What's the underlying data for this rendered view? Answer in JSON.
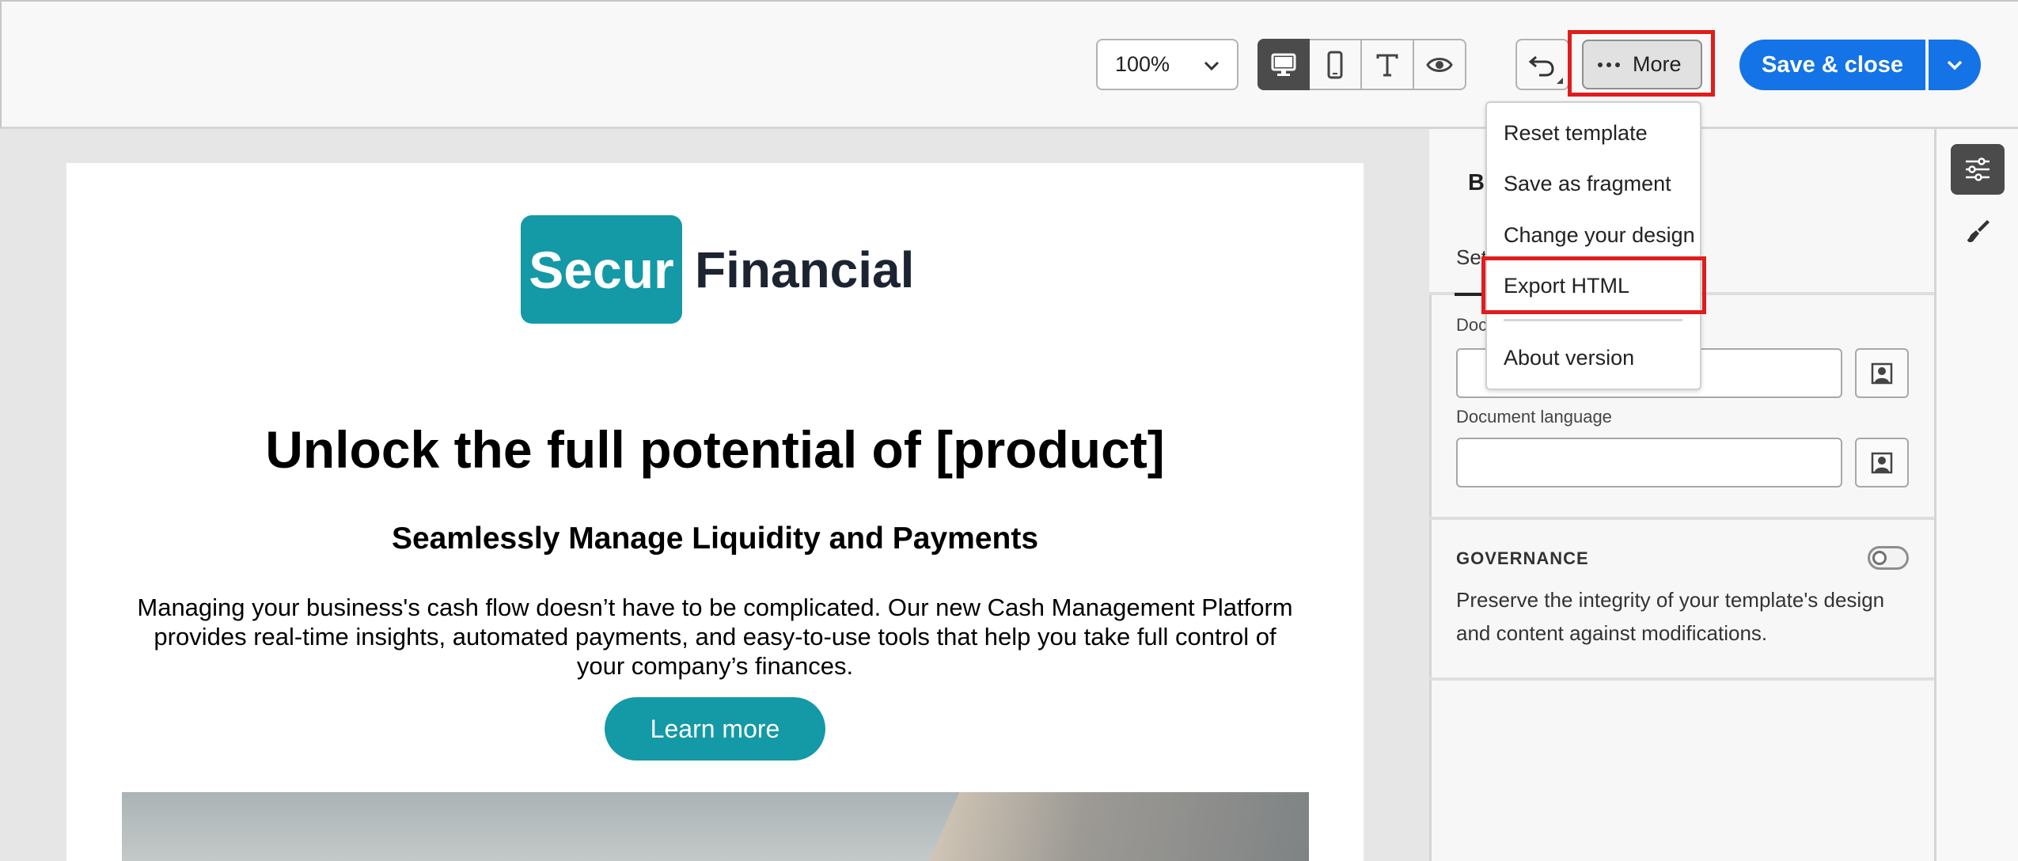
{
  "toolbar": {
    "zoom_value": "100%",
    "view_modes": [
      "desktop-icon",
      "mobile-icon",
      "text-icon",
      "preview-eye-icon"
    ],
    "more_label": "More",
    "save_label": "Save & close",
    "accent_color": "#1473e6",
    "highlight_color": "#e01c1c"
  },
  "more_menu": {
    "items": [
      "Reset template",
      "Save as fragment",
      "Change your design",
      "Export HTML",
      "About version"
    ],
    "highlighted": "Export HTML"
  },
  "email": {
    "logo_box_text": "Secur",
    "logo_text": "Financial",
    "title": "Unlock the full potential of [product]",
    "subtitle": "Seamlessly Manage Liquidity and Payments",
    "body": "Managing your business's cash flow doesn’t have to be complicated. Our new Cash Management Platform provides real-time insights, automated payments, and easy-to-use tools that help you take full control of your company’s finances.",
    "cta_label": "Learn more",
    "brand_color": "#1499a6"
  },
  "panel": {
    "title_partial": "B",
    "tab_partial": "Set",
    "field1_label_partial": "Doc",
    "field2_label": "Document language",
    "governance_title": "GOVERNANCE",
    "governance_enabled": false,
    "governance_text": "Preserve the integrity of your template's design and content against modifications."
  },
  "rail": {
    "icons": [
      "settings-sliders-icon",
      "brush-icon"
    ]
  }
}
